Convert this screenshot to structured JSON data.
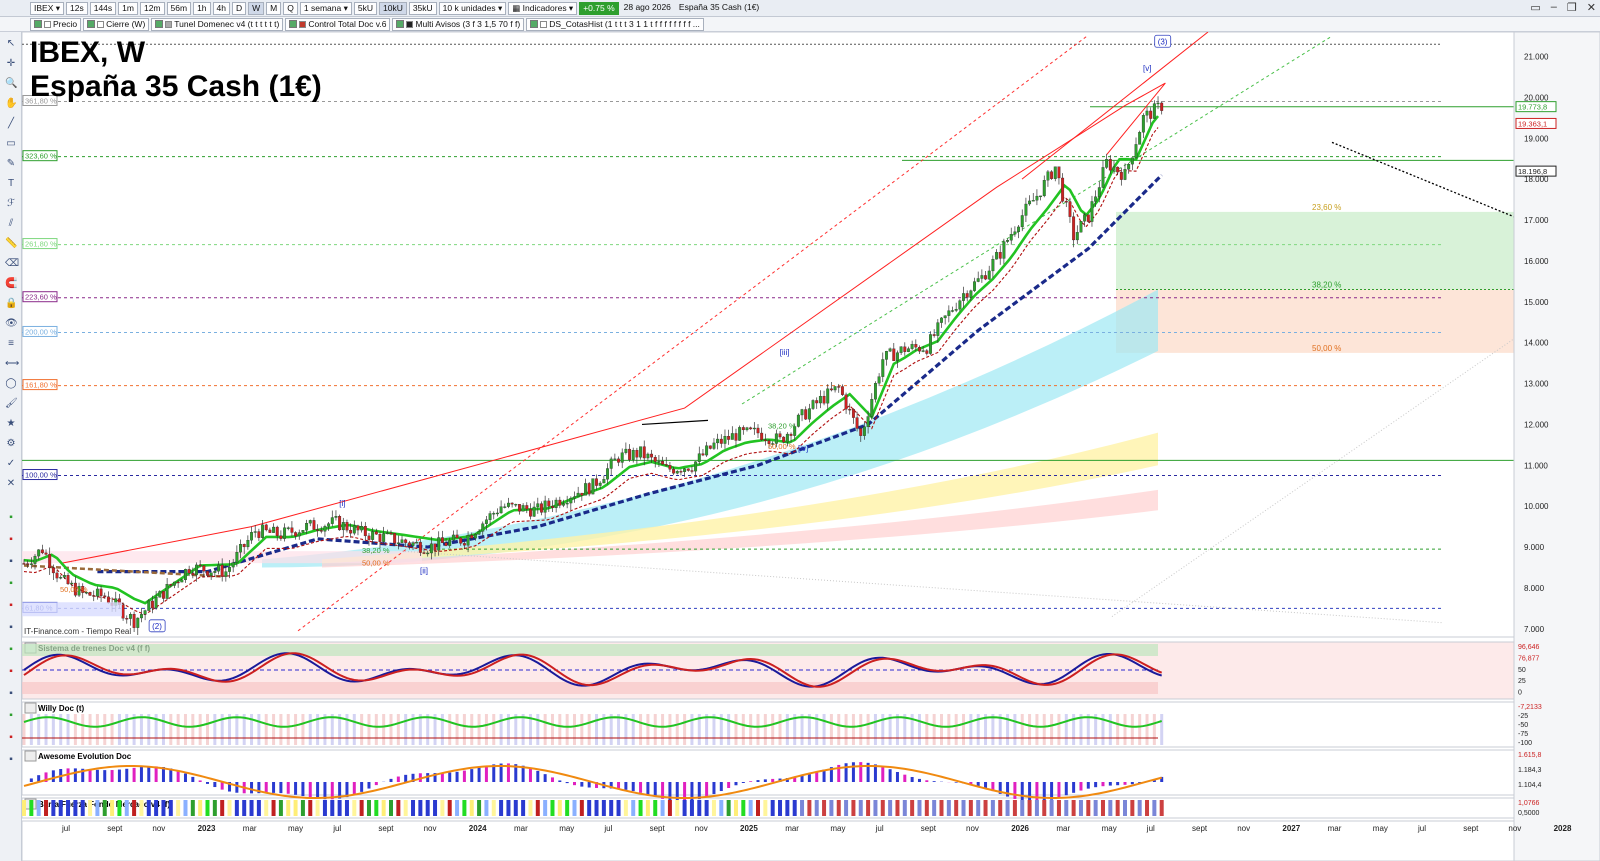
{
  "window": {
    "symbol": "IBEX",
    "timeframes": [
      "12s",
      "144s",
      "1m",
      "12m",
      "56m",
      "1h",
      "4h",
      "D",
      "W",
      "M",
      "Q"
    ],
    "active_timeframe": "W",
    "period": "1 semana",
    "units": [
      "5kU",
      "10kU",
      "35kU"
    ],
    "active_unit": "10kU",
    "units_select": "10 k unidades",
    "indicators_label": "Indicadores",
    "change": "+0.75 %",
    "date": "28 ago 2026",
    "instrument": "España 35 Cash (1€)",
    "controls": [
      "▭",
      "–",
      "❐",
      "✕"
    ]
  },
  "legend_bar": {
    "items": [
      {
        "label": "Precio",
        "color": "#ffffff"
      },
      {
        "label": "Cierre (W)",
        "color": "#ffffff"
      },
      {
        "label": "Tunel Domenec v4 (t t t t t t)",
        "color": "#aaaaaa"
      },
      {
        "label": "Control Total Doc v.6",
        "color": "#c0392b"
      },
      {
        "label": "Multi Avisos (3 f 3 1,5 70 f f)",
        "color": "#222222"
      },
      {
        "label": "DS_CotasHist (1 t t t 3 1 1 t f f f f f f f f ...",
        "color": "#ffffff"
      }
    ]
  },
  "sidebar": {
    "icons": [
      "cursor-icon",
      "crosshair-icon",
      "zoom-icon",
      "pan-icon",
      "trendline-icon",
      "rectangle-icon",
      "pencil-icon",
      "text-icon",
      "fibonacci-icon",
      "channel-icon",
      "ruler-icon",
      "eraser-icon",
      "magnet-icon",
      "lock-icon",
      "eye-icon",
      "layers-icon",
      "measure-icon",
      "elliptic-icon",
      "brush-icon",
      "star-icon",
      "settings-icon",
      "check-icon",
      "delete-icon"
    ]
  },
  "chart_title": {
    "line1": "IBEX, W",
    "line2": "España 35 Cash (1€)"
  },
  "source_label": "IT-Finance.com - Tiempo Real",
  "colors": {
    "up_candle": "#2e9f2e",
    "down_candle": "#cc2222",
    "green_ma": "#22c322",
    "blue_ma": "#1a2a8a",
    "red_line": "#ff2020"
  },
  "chart_data": {
    "type": "candlestick",
    "title": "IBEX, W",
    "subtitle": "España 35 Cash (1€)",
    "ylim": [
      6.8,
      21.6
    ],
    "y_ticks": [
      "21.000",
      "20.000",
      "19.000",
      "18.000",
      "17.000",
      "16.000",
      "15.000",
      "14.000",
      "13.000",
      "12.000",
      "11.000",
      "10.000",
      "9.000",
      "8.000",
      "7.000"
    ],
    "x_ticks": [
      "jul",
      "sept",
      "nov",
      "2023",
      "mar",
      "may",
      "jul",
      "sept",
      "nov",
      "2024",
      "mar",
      "may",
      "jul",
      "sept",
      "nov",
      "2025",
      "mar",
      "may",
      "jul",
      "sept",
      "nov",
      "2026",
      "mar",
      "may",
      "jul",
      "sept",
      "nov",
      "2027",
      "mar",
      "may",
      "jul",
      "sept",
      "nov",
      "2028"
    ],
    "price_markers": [
      {
        "label": "19.773,8",
        "value": 19773.8,
        "color": "#2e9f2e"
      },
      {
        "label": "19.363,1",
        "value": 19363.1,
        "color": "#cc2222"
      },
      {
        "label": "18.196,8",
        "value": 18196.8,
        "color": "#222222"
      }
    ],
    "fib_levels_left": [
      {
        "label": "361,80 %",
        "value": 19.9,
        "color": "#999999"
      },
      {
        "label": "323,60 %",
        "value": 18.55,
        "color": "#2e9f2e"
      },
      {
        "label": "261,80 %",
        "value": 16.4,
        "color": "#7fd87f"
      },
      {
        "label": "223,60 %",
        "value": 15.1,
        "color": "#8a2a8a"
      },
      {
        "label": "200,00 %",
        "value": 14.25,
        "color": "#7ab0e0"
      },
      {
        "label": "161,80 %",
        "value": 12.95,
        "color": "#f07030"
      },
      {
        "label": "100,00 %",
        "value": 10.75,
        "color": "#2a2aa0"
      },
      {
        "label": "61,80 %",
        "value": 7.5,
        "color": "#3040c0"
      }
    ],
    "fib_box": [
      {
        "label": "23,60 %",
        "value": 17.2,
        "color": "#c8a020"
      },
      {
        "label": "38,20 %",
        "value": 15.3,
        "color": "#2e9f2e"
      },
      {
        "label": "50,00 %",
        "value": 13.75,
        "color": "#e07020"
      }
    ],
    "small_fibs": [
      {
        "label": "50,00 %",
        "value": 7.9,
        "color": "#e07020"
      },
      {
        "label": "38,20 %",
        "value": 8.85,
        "color": "#2e9f2e"
      },
      {
        "label": "50,00 %",
        "value": 8.55,
        "color": "#e07020"
      },
      {
        "label": "38,20 %",
        "value": 11.9,
        "color": "#2e9f2e"
      },
      {
        "label": "50,00 %",
        "value": 11.4,
        "color": "#e07020"
      }
    ],
    "wave_labels": [
      "(2)",
      "[i]",
      "[ii]",
      "[iii]",
      "[iv]",
      "[v]",
      "(3)"
    ],
    "horizontal_levels": [
      21.3,
      19.9,
      19.77,
      18.46,
      16.4,
      15.1,
      14.25,
      12.95,
      11.1,
      10.75,
      8.95
    ],
    "series": [
      {
        "name": "Precio",
        "x": [
          0,
          5,
          10,
          16,
          22,
          30,
          37,
          45,
          55,
          63,
          70,
          77,
          85,
          92,
          100,
          110,
          120,
          130,
          140,
          148,
          155,
          162,
          168,
          175,
          182,
          188,
          194,
          200,
          206,
          212,
          217,
          222,
          228,
          234,
          240,
          246,
          251,
          256,
          261,
          266,
          271,
          276,
          281,
          286,
          290,
          295,
          300,
          305,
          310
        ],
        "values": [
          8.6,
          8.95,
          8.2,
          7.85,
          7.8,
          7.2,
          7.8,
          8.5,
          8.4,
          9.4,
          9.3,
          9.5,
          9.6,
          9.35,
          9.2,
          9.0,
          9.2,
          10.0,
          9.9,
          10.25,
          10.5,
          11.2,
          11.3,
          10.9,
          11.0,
          11.5,
          11.75,
          11.8,
          11.6,
          12.2,
          12.6,
          12.9,
          11.7,
          13.6,
          13.85,
          13.9,
          14.6,
          15.2,
          15.6,
          16.2,
          17.0,
          17.6,
          18.3,
          16.6,
          17.1,
          18.4,
          18.1,
          19.5,
          19.8
        ]
      },
      {
        "name": "Tunel green",
        "x": [
          0,
          30,
          60,
          90,
          120,
          150,
          180,
          210,
          240,
          270,
          300,
          310
        ],
        "values": [
          8.8,
          8.2,
          8.9,
          9.5,
          9.4,
          10.2,
          11.0,
          11.5,
          13.5,
          16.0,
          18.8,
          19.6
        ]
      },
      {
        "name": "Tunel blue",
        "x": [
          20,
          50,
          80,
          110,
          140,
          170,
          200,
          230,
          260,
          290,
          310
        ],
        "values": [
          8.4,
          8.4,
          9.2,
          9.0,
          9.5,
          10.3,
          11.0,
          12.0,
          14.3,
          16.3,
          18.1
        ]
      }
    ],
    "subpanels": [
      {
        "name": "Sistema de trenes Doc v4 (f f)",
        "values": [
          "96,646",
          "76,877",
          "50",
          "25",
          "0"
        ]
      },
      {
        "name": "Willy Doc (t)",
        "values": [
          "-7,2133",
          "-25",
          "-50",
          "-75",
          "-100"
        ]
      },
      {
        "name": "Awesome Evolution Doc",
        "values": [
          "1.615,8",
          "1.184,3",
          "1.104,4"
        ]
      },
      {
        "name": "Barra Fuerza Fondo Mercado v4 (f)",
        "values": [
          "1,0766",
          "0,5000"
        ]
      }
    ]
  }
}
